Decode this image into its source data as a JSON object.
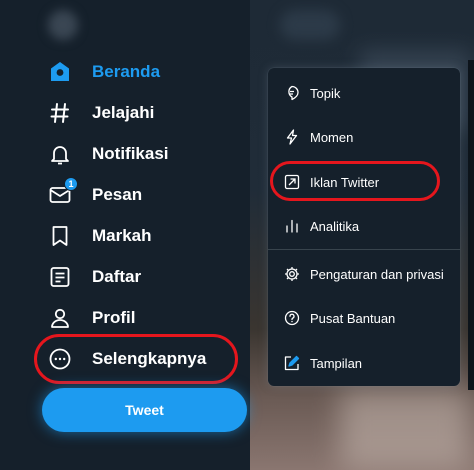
{
  "sidebar": {
    "items": [
      {
        "label": "Beranda",
        "icon": "home-icon",
        "active": true
      },
      {
        "label": "Jelajahi",
        "icon": "hashtag-icon"
      },
      {
        "label": "Notifikasi",
        "icon": "bell-icon"
      },
      {
        "label": "Pesan",
        "icon": "mail-icon",
        "badge": "1"
      },
      {
        "label": "Markah",
        "icon": "bookmark-icon"
      },
      {
        "label": "Daftar",
        "icon": "list-icon"
      },
      {
        "label": "Profil",
        "icon": "user-icon"
      },
      {
        "label": "Selengkapnya",
        "icon": "more-circle-icon"
      }
    ],
    "tweet_button": "Tweet"
  },
  "menu": {
    "items": [
      {
        "label": "Topik",
        "icon": "topic-icon"
      },
      {
        "label": "Momen",
        "icon": "lightning-icon"
      },
      {
        "label": "Iklan Twitter",
        "icon": "external-arrow-icon"
      },
      {
        "label": "Analitika",
        "icon": "bar-chart-icon"
      },
      {
        "label": "Pengaturan dan privasi",
        "icon": "gear-icon"
      },
      {
        "label": "Pusat Bantuan",
        "icon": "help-icon"
      },
      {
        "label": "Tampilan",
        "icon": "display-edit-icon"
      }
    ]
  },
  "colors": {
    "background": "#15202b",
    "accent": "#1d9bf0",
    "highlight": "#e5161d",
    "divider": "#38444d"
  }
}
